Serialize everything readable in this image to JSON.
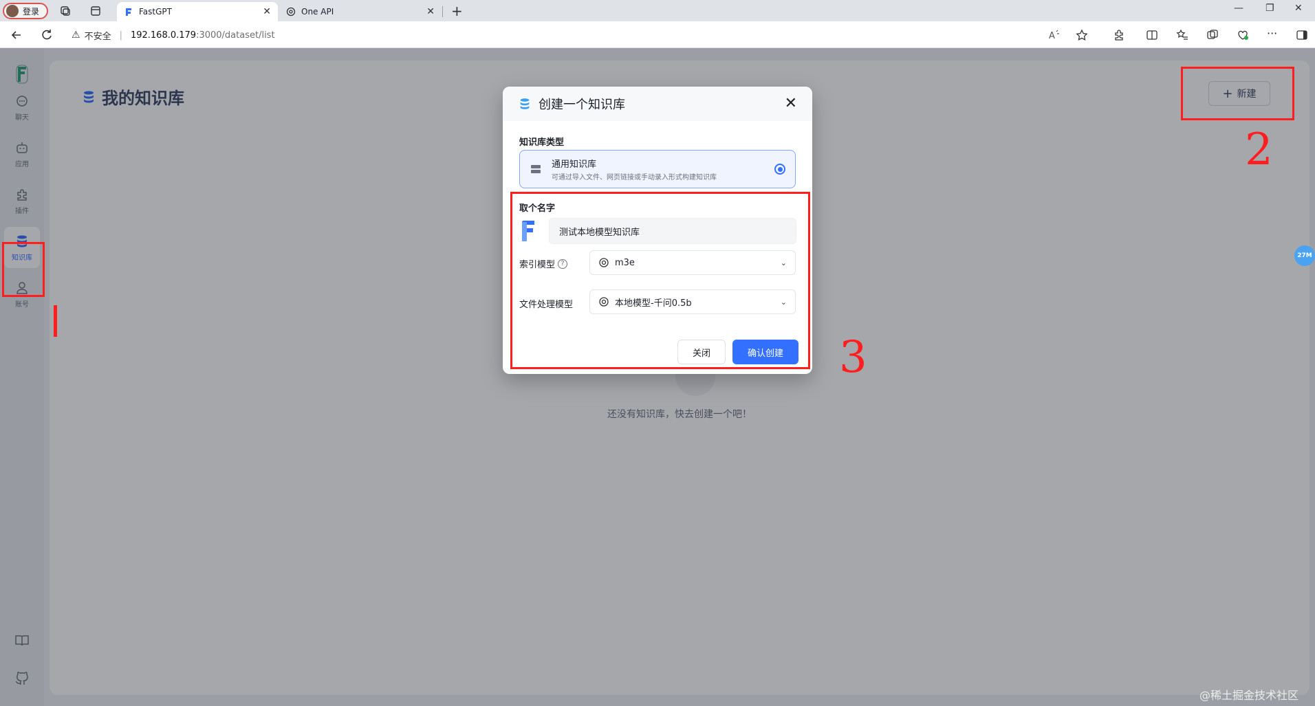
{
  "browser": {
    "profile_label": "登录",
    "tabs": [
      {
        "label": "FastGPT",
        "active": true
      },
      {
        "label": "One API",
        "active": false
      }
    ],
    "url": {
      "security_label": "不安全",
      "host": "192.168.0.179",
      "path": ":3000/dataset/list"
    }
  },
  "sidebar": {
    "items": [
      {
        "label": "聊天",
        "icon": "chat-icon"
      },
      {
        "label": "应用",
        "icon": "robot-icon"
      },
      {
        "label": "插件",
        "icon": "puzzle-icon"
      },
      {
        "label": "知识库",
        "icon": "database-icon",
        "active": true
      },
      {
        "label": "账号",
        "icon": "user-icon"
      }
    ]
  },
  "page": {
    "title": "我的知识库",
    "new_button": "新建",
    "empty_text": "还没有知识库，快去创建一个吧！"
  },
  "modal": {
    "title": "创建一个知识库",
    "type_label": "知识库类型",
    "type_option": {
      "title": "通用知识库",
      "desc": "可通过导入文件、网页链接或手动录入形式构建知识库"
    },
    "name_label": "取个名字",
    "name_value": "测试本地模型知识库",
    "index_model_label": "索引模型",
    "index_model_value": "m3e",
    "file_model_label": "文件处理模型",
    "file_model_value": "本地模型-千问0.5b",
    "close_button": "关闭",
    "confirm_button": "确认创建"
  },
  "annotations": {
    "label_1": "1",
    "label_2": "2",
    "label_3": "3",
    "color": "#ff1e1e"
  },
  "side_badge": "27M",
  "watermark": "@稀土掘金技术社区",
  "colors": {
    "accent": "#3370ff"
  }
}
